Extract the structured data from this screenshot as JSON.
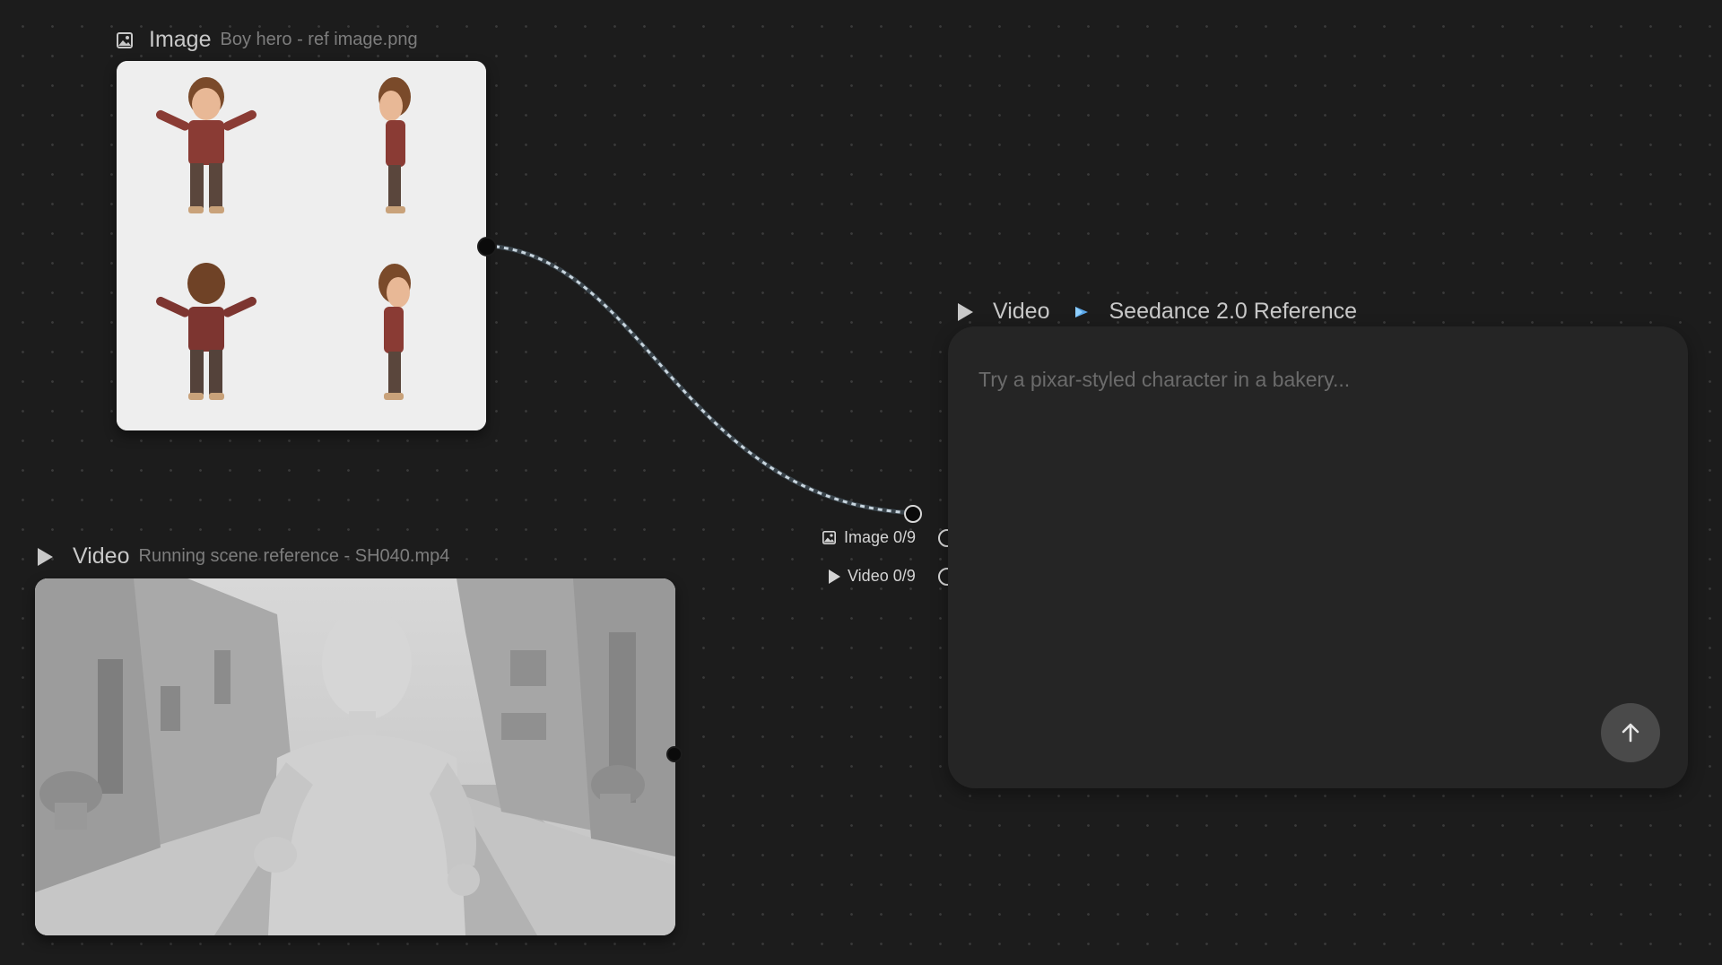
{
  "image_node": {
    "type_label": "Image",
    "subtitle": "Boy hero - ref image.png",
    "icon": "image-icon",
    "preview_description_icon": "character-turnaround"
  },
  "video_ref_node": {
    "type_label": "Video",
    "subtitle": "Running scene reference - SH040.mp4",
    "icon": "play-icon"
  },
  "generator_node": {
    "type_label": "Video",
    "model_label": "Seedance 2.0 Reference",
    "model_icon": "seedance-logo-icon",
    "prompt_placeholder": "Try a pixar-styled character in a bakery...",
    "inputs": [
      {
        "icon": "image-icon",
        "label": "Image 0/9"
      },
      {
        "icon": "play-icon",
        "label": "Video 0/9"
      }
    ],
    "send_icon": "arrow-up-icon"
  },
  "colors": {
    "canvas_bg": "#1c1c1c",
    "panel_bg": "#252525",
    "text_primary": "#c8c8c8",
    "text_secondary": "#7d7d7d",
    "edge": "#b8c8d4"
  }
}
